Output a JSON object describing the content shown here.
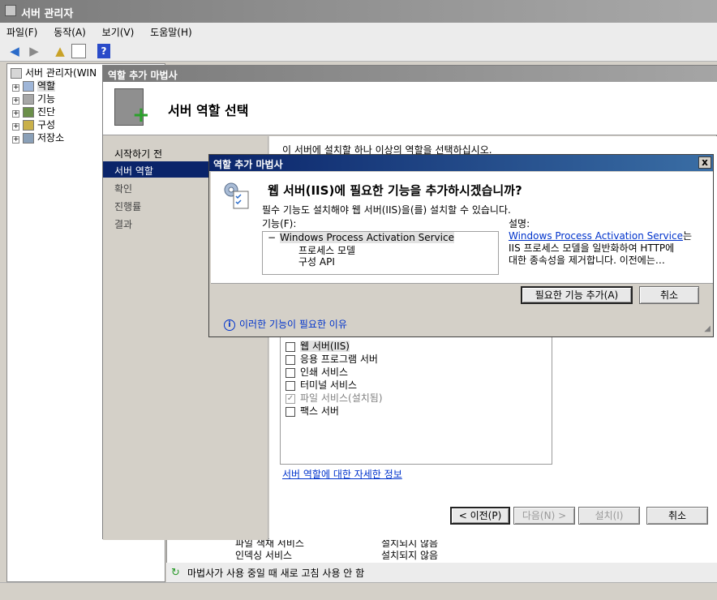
{
  "window": {
    "title": "서버 관리자"
  },
  "menu": [
    "파일(F)",
    "동작(A)",
    "보기(V)",
    "도움말(H)"
  ],
  "tree": {
    "root": "서버 관리자(WIN",
    "items": [
      "역할",
      "기능",
      "진단",
      "구성",
      "저장소"
    ]
  },
  "background_rows": [
    {
      "name": "파일 색채 서비스",
      "status": "설치되지 않음"
    },
    {
      "name": "인덱싱 서비스",
      "status": "설치되지 않음"
    }
  ],
  "status_line": "마법사가 사용 중일 때 새로 고침 사용 안 함",
  "wizard": {
    "title": "역할 추가 마법사",
    "header_title": "서버 역할 선택",
    "nav": [
      "시작하기 전",
      "서버 역할",
      "확인",
      "진행률",
      "결과"
    ],
    "intro_partial": "이 서버에 설치할 하나 이상의 역할을 선택하십시오.",
    "roles": [
      {
        "label": "웹 서버(IIS)",
        "checked": false,
        "disabled": false
      },
      {
        "label": "응용 프로그램 서버",
        "checked": false,
        "disabled": false
      },
      {
        "label": "인쇄 서비스",
        "checked": false,
        "disabled": false
      },
      {
        "label": "터미널 서비스",
        "checked": false,
        "disabled": false
      },
      {
        "label": "파일 서비스(설치됨)",
        "checked": true,
        "disabled": true
      },
      {
        "label": "팩스 서버",
        "checked": false,
        "disabled": false
      }
    ],
    "more_info_link": "서버 역할에 대한 자세한 정보",
    "buttons": {
      "prev": "< 이전(P)",
      "next": "다음(N) >",
      "install": "설치(I)",
      "cancel": "취소"
    }
  },
  "dialog": {
    "title": "역할 추가 마법사",
    "close": "x",
    "question": "웹 서버(IIS)에 필요한 기능을 추가하시겠습니까?",
    "subtitle": "필수 기능도 설치해야 웹 서버(IIS)을(를) 설치할 수 있습니다.",
    "features_label": "기능(F):",
    "features": {
      "parent": "Windows Process Activation Service",
      "toggle": "−",
      "children": [
        "프로세스 모델",
        "구성 API"
      ]
    },
    "description_label": "설명:",
    "description_link": "Windows Process Activation Service",
    "description_suffix": "는",
    "description_lines": [
      "IIS 프로세스 모델을 일반화하여 HTTP에",
      "대한 종속성을 제거합니다. 이전에는…"
    ],
    "buttons": {
      "add": "필요한 기능 추가(A)",
      "cancel": "취소"
    },
    "why_link": "이러한 기능이 필요한 이유"
  }
}
